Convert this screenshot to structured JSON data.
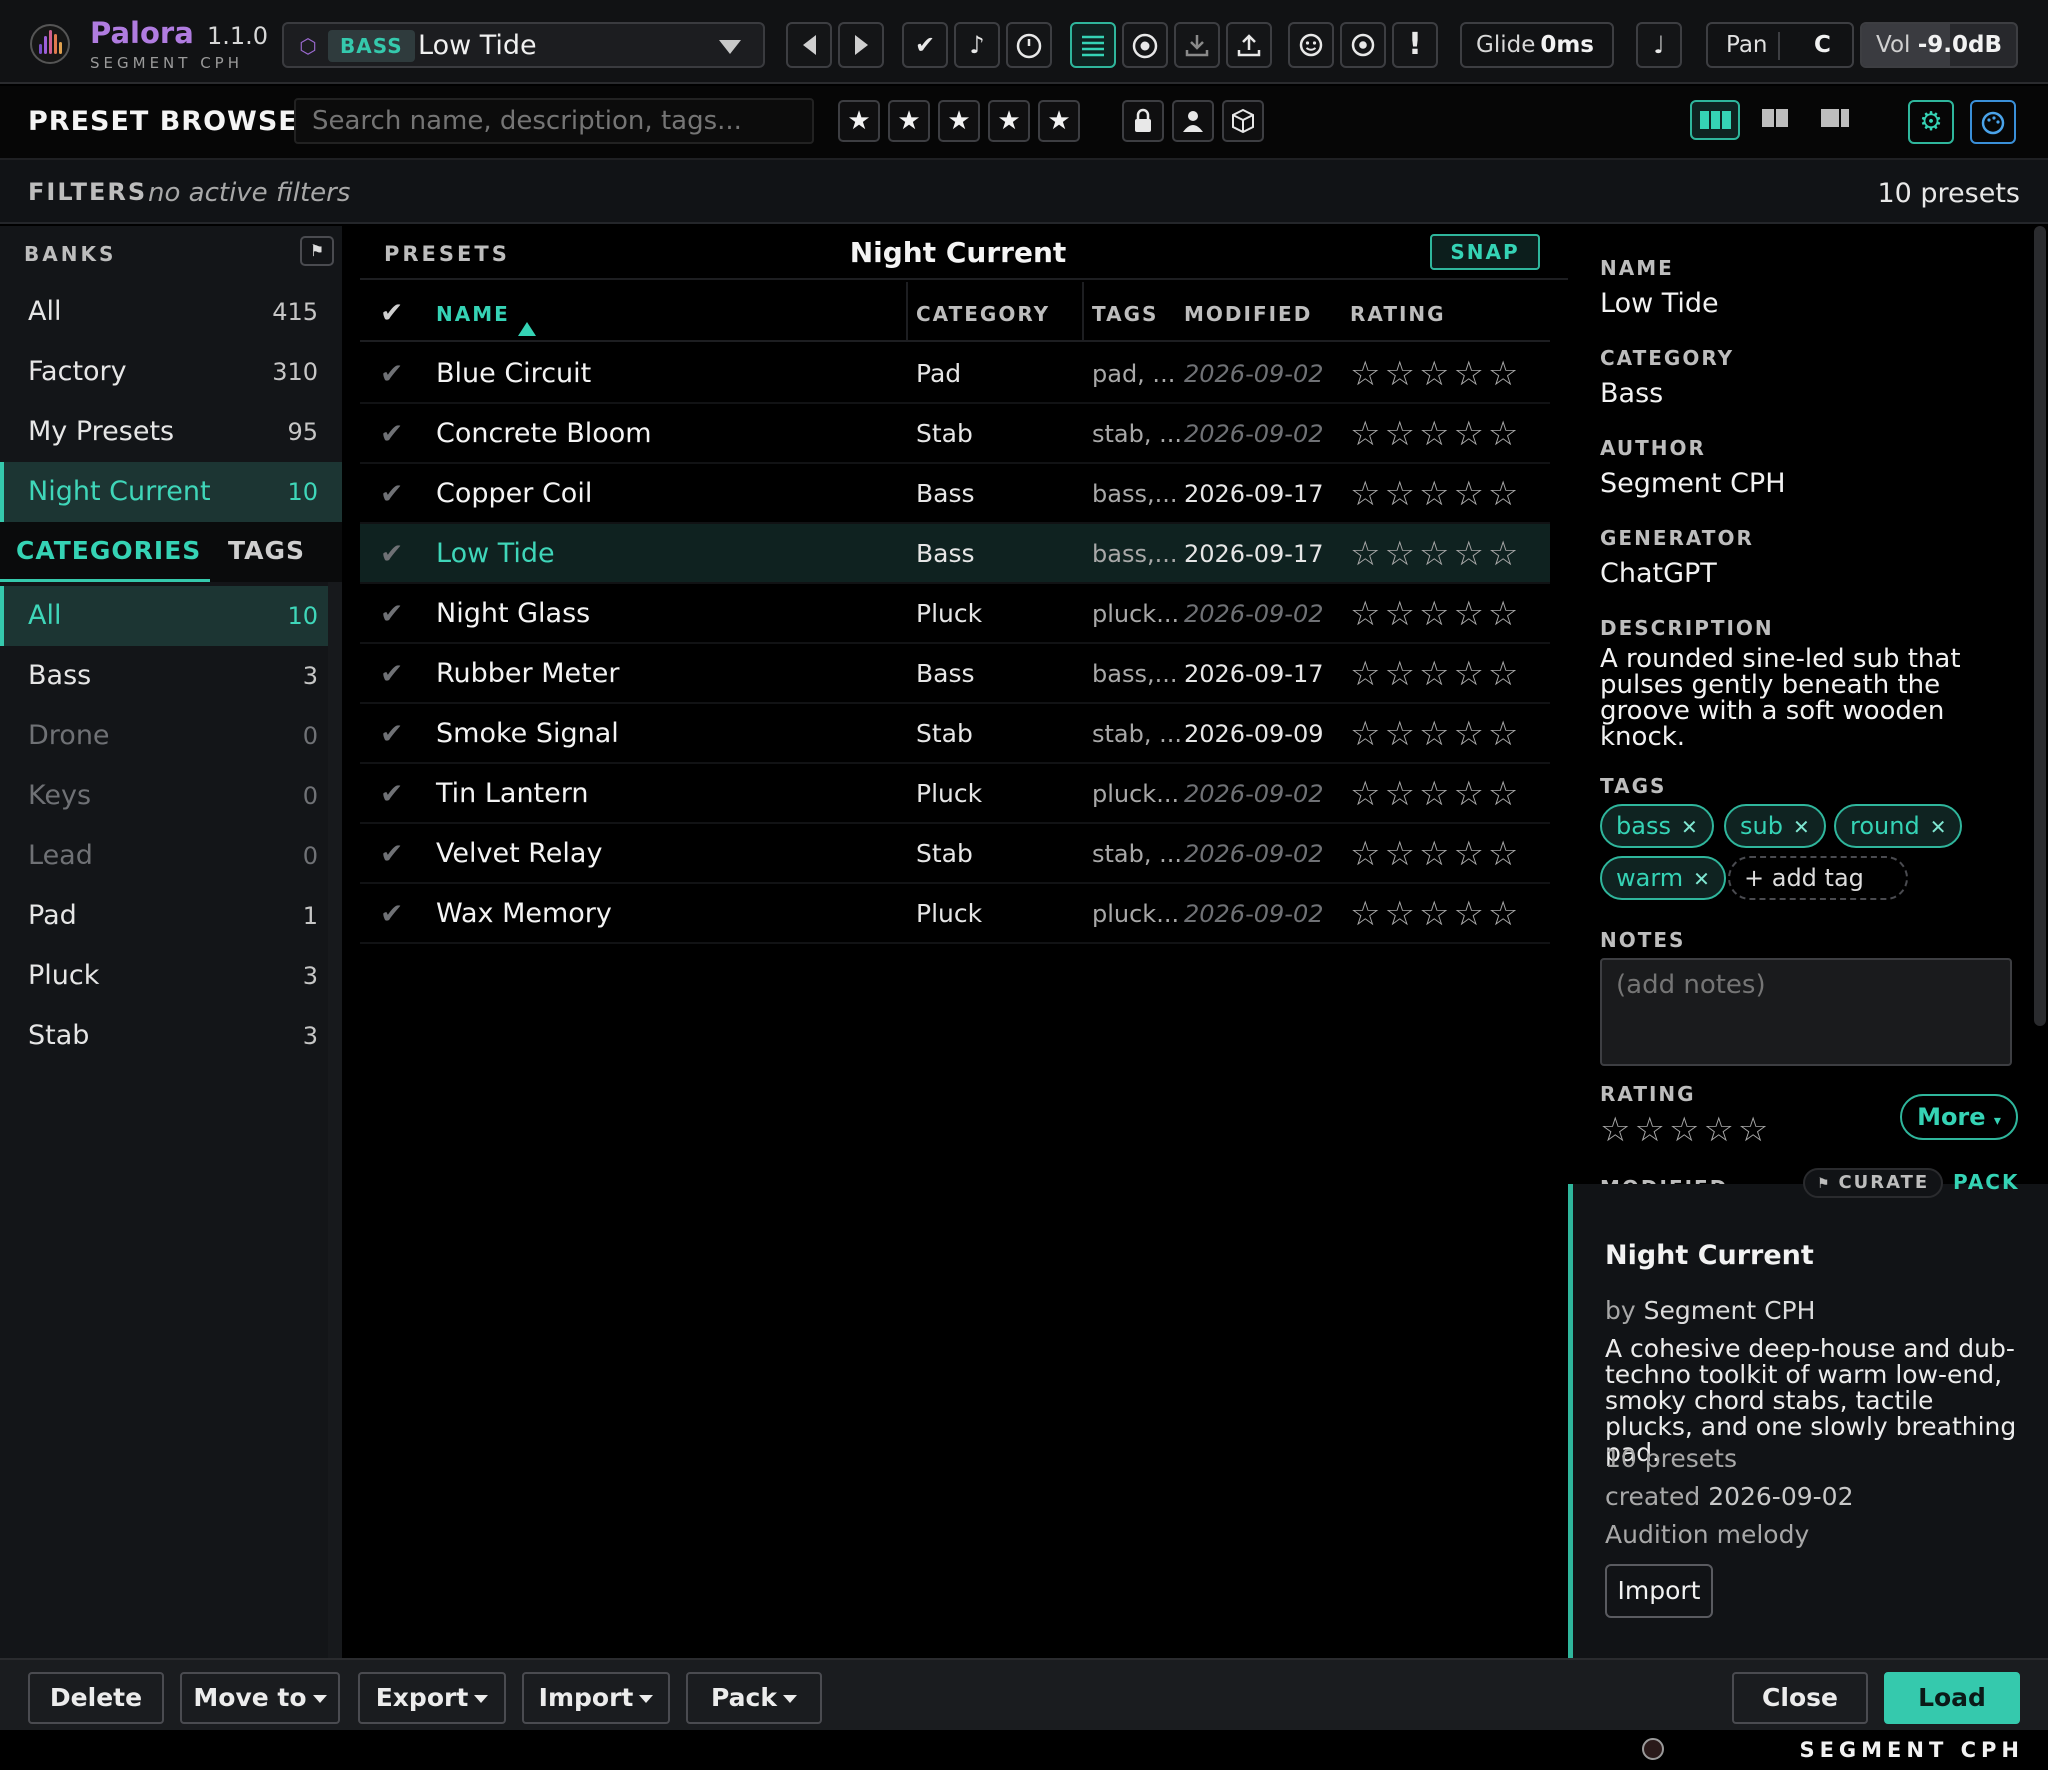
{
  "app": {
    "name": "Palora",
    "version": "1.1.0",
    "brand": "SEGMENT CPH"
  },
  "topbar": {
    "preset_category": "BASS",
    "preset_name": "Low Tide",
    "glide_label": "Glide",
    "glide_value": "0ms",
    "pan_label": "Pan",
    "pan_value": "C",
    "vol_label": "Vol",
    "vol_value": "-9.0dB",
    "check_glyph": "✔",
    "note_glyph": "♪",
    "note2_glyph": "♩",
    "excl_glyph": "!"
  },
  "browser": {
    "title": "PRESET BROWSER",
    "search_placeholder": "Search name, description, tags...",
    "star_glyph": "★"
  },
  "filters": {
    "label": "FILTERS",
    "value": "no active filters",
    "count": "10 presets"
  },
  "sidebar": {
    "banks_label": "BANKS",
    "banks": [
      {
        "name": "All",
        "count": "415"
      },
      {
        "name": "Factory",
        "count": "310"
      },
      {
        "name": "My Presets",
        "count": "95"
      },
      {
        "name": "Night Current",
        "count": "10"
      }
    ],
    "tabs": {
      "categories": "CATEGORIES",
      "tags": "TAGS"
    },
    "categories": [
      {
        "name": "All",
        "count": "10"
      },
      {
        "name": "Bass",
        "count": "3"
      },
      {
        "name": "Drone",
        "count": "0"
      },
      {
        "name": "Keys",
        "count": "0"
      },
      {
        "name": "Lead",
        "count": "0"
      },
      {
        "name": "Pad",
        "count": "1"
      },
      {
        "name": "Pluck",
        "count": "3"
      },
      {
        "name": "Stab",
        "count": "3"
      }
    ]
  },
  "list": {
    "label": "PRESETS",
    "bank_title": "Night Current",
    "snap_label": "SNAP",
    "columns": {
      "name": "NAME",
      "category": "CATEGORY",
      "tags": "TAGS",
      "modified": "MODIFIED",
      "rating": "RATING"
    },
    "stars": "☆☆☆☆☆",
    "rows": [
      {
        "name": "Blue Circuit",
        "category": "Pad",
        "tags": "pad, ...",
        "modified": "2026-09-02"
      },
      {
        "name": "Concrete Bloom",
        "category": "Stab",
        "tags": "stab, ...",
        "modified": "2026-09-02"
      },
      {
        "name": "Copper Coil",
        "category": "Bass",
        "tags": "bass,...",
        "modified": "2026-09-17"
      },
      {
        "name": "Low Tide",
        "category": "Bass",
        "tags": "bass,...",
        "modified": "2026-09-17"
      },
      {
        "name": "Night Glass",
        "category": "Pluck",
        "tags": "pluck...",
        "modified": "2026-09-02"
      },
      {
        "name": "Rubber Meter",
        "category": "Bass",
        "tags": "bass,...",
        "modified": "2026-09-17"
      },
      {
        "name": "Smoke Signal",
        "category": "Stab",
        "tags": "stab, ...",
        "modified": "2026-09-09"
      },
      {
        "name": "Tin Lantern",
        "category": "Pluck",
        "tags": "pluck...",
        "modified": "2026-09-02"
      },
      {
        "name": "Velvet Relay",
        "category": "Stab",
        "tags": "stab, ...",
        "modified": "2026-09-02"
      },
      {
        "name": "Wax Memory",
        "category": "Pluck",
        "tags": "pluck...",
        "modified": "2026-09-02"
      }
    ]
  },
  "detail": {
    "name_label": "NAME",
    "name": "Low Tide",
    "category_label": "CATEGORY",
    "category": "Bass",
    "author_label": "AUTHOR",
    "author": "Segment CPH",
    "generator_label": "GENERATOR",
    "generator": "ChatGPT",
    "description_label": "DESCRIPTION",
    "description": "A rounded sine-led sub that pulses gently beneath the groove with a soft wooden knock.",
    "tags_label": "TAGS",
    "tags": [
      "bass",
      "sub",
      "round",
      "warm"
    ],
    "add_tag": "+ add tag",
    "notes_label": "NOTES",
    "notes_placeholder": "(add notes)",
    "rating_label": "RATING",
    "rating_stars": "☆☆☆☆☆",
    "more_label": "More",
    "modified_label": "MODIFIED"
  },
  "pack": {
    "curate_label": "CURATE",
    "pack_label": "PACK",
    "title": "Night Current",
    "by_prefix": "by",
    "author": "Segment CPH",
    "description": "A cohesive deep-house and dub-techno toolkit of warm low-end, smoky chord stabs, tactile plucks, and one slowly breathing pad.",
    "count": "10 presets",
    "created_prefix": "created",
    "created": "2026-09-02",
    "audition": "Audition melody",
    "import_label": "Import"
  },
  "bottom": {
    "delete": "Delete",
    "move_to": "Move to",
    "export": "Export",
    "import": "Import",
    "pack": "Pack",
    "close": "Close",
    "load": "Load"
  },
  "colors": {
    "accent": "#35c9ad",
    "brand": "#b07ce0",
    "panel": "#131518",
    "selected_row": "#0f2220"
  },
  "icons": [
    "logo-icon",
    "cube-icon",
    "chevron-down-icon",
    "prev-icon",
    "next-icon",
    "check-icon",
    "note-icon",
    "clock-icon",
    "list-icon",
    "record-icon",
    "download-icon",
    "upload-icon",
    "face-icon",
    "target-icon",
    "alert-icon",
    "star-icon",
    "lock-icon",
    "user-icon",
    "box-icon",
    "layout-icon",
    "gear-icon",
    "palette-icon",
    "flag-icon",
    "sort-asc-icon"
  ]
}
